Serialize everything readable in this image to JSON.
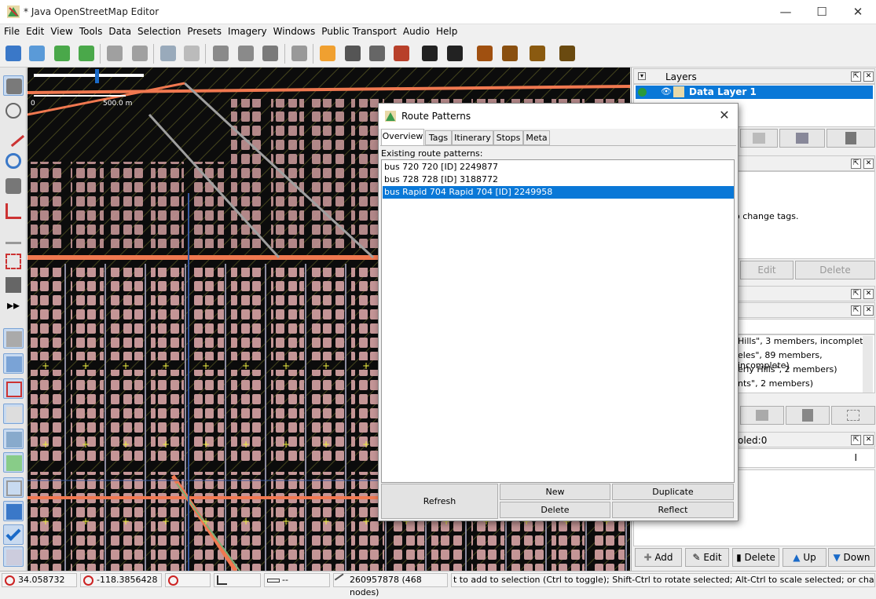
{
  "window": {
    "title": "* Java OpenStreetMap Editor",
    "minimize": "—",
    "maximize": "☐",
    "close": "✕"
  },
  "menu": [
    "File",
    "Edit",
    "View",
    "Tools",
    "Data",
    "Selection",
    "Presets",
    "Imagery",
    "Windows",
    "Public Transport",
    "Audio",
    "Help"
  ],
  "map": {
    "scale_label": "500.0 m"
  },
  "layers_panel": {
    "title": "Layers",
    "layer_name": "Data Layer 1"
  },
  "tags_panel": {
    "hint": "o change tags.",
    "edit": "Edit",
    "delete": "Delete"
  },
  "relations_panel": {
    "items": [
      "Hills\", 3 members, incomplete)",
      "eles\", 89 members, incomplete)",
      "erly Hills\", 2 members)",
      "nts\", 2 members)"
    ]
  },
  "selection_panel": {
    "title": "oled:0",
    "cursor": "I"
  },
  "bottom_buttons": {
    "add": "Add",
    "edit": "Edit",
    "delete": "Delete",
    "up": "Up",
    "down": "Down"
  },
  "status": {
    "lat": "34.058732",
    "lon": "-118.3856428",
    "angle": "",
    "heading": "",
    "distance": "--",
    "selection": "260957878 (468 nodes)",
    "help": "t to add to selection (Ctrl to toggle); Shift-Ctrl to rotate selected; Alt-Ctrl to scale selected; or change selection"
  },
  "dialog": {
    "title": "Route Patterns",
    "tabs": [
      "Overview",
      "Tags",
      "Itinerary",
      "Stops",
      "Meta"
    ],
    "list_label": "Existing route patterns:",
    "patterns": [
      "bus 720 720 [ID] 2249877",
      "bus 728 728 [ID] 3188772",
      "bus Rapid 704 Rapid 704 [ID] 2249958"
    ],
    "selected_index": 2,
    "buttons": {
      "refresh": "Refresh",
      "new": "New",
      "duplicate": "Duplicate",
      "delete": "Delete",
      "reflect": "Reflect"
    }
  },
  "colors": {
    "selection_blue": "#0a78d7",
    "map_bg": "#0c0c0c",
    "building": "#c89a9a",
    "road_orange": "#f07850"
  }
}
